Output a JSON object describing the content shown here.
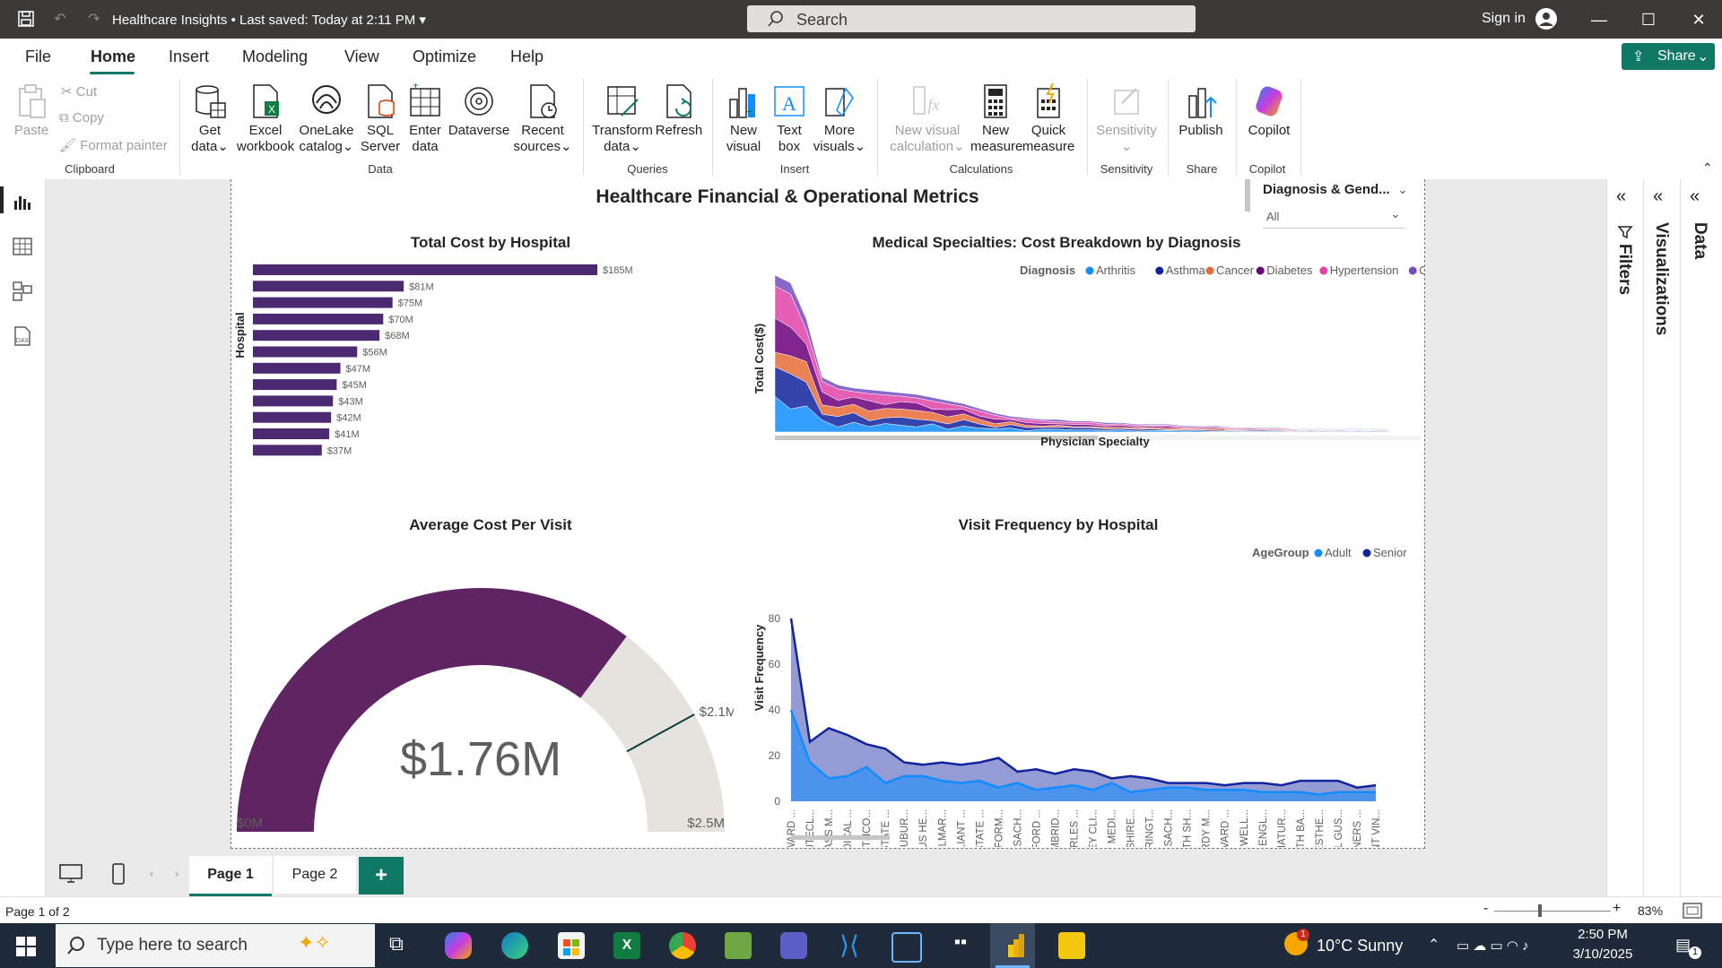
{
  "titlebar": {
    "app_title": "Healthcare Insights",
    "saved_status": "Last saved: Today at 2:11 PM",
    "search_placeholder": "Search",
    "sign_in": "Sign in"
  },
  "menu": {
    "items": [
      "File",
      "Home",
      "Insert",
      "Modeling",
      "View",
      "Optimize",
      "Help"
    ],
    "active": "Home",
    "share_label": "Share"
  },
  "ribbon": {
    "clipboard": {
      "paste": "Paste",
      "cut": "Cut",
      "copy": "Copy",
      "format_painter": "Format painter",
      "group": "Clipboard"
    },
    "data": {
      "get_data": [
        "Get",
        "data"
      ],
      "excel": [
        "Excel",
        "workbook"
      ],
      "onelake": [
        "OneLake",
        "catalog"
      ],
      "sql": [
        "SQL",
        "Server"
      ],
      "enter": [
        "Enter",
        "data"
      ],
      "dataverse": [
        "Dataverse",
        ""
      ],
      "recent": [
        "Recent",
        "sources"
      ],
      "group": "Data"
    },
    "queries": {
      "transform": [
        "Transform",
        "data"
      ],
      "refresh": [
        "Refresh",
        ""
      ],
      "group": "Queries"
    },
    "insert": {
      "new_visual": [
        "New",
        "visual"
      ],
      "text_box": [
        "Text",
        "box"
      ],
      "more_visuals": [
        "More",
        "visuals"
      ],
      "group": "Insert"
    },
    "calculations": {
      "new_visual_calc": [
        "New visual",
        "calculation"
      ],
      "new_measure": [
        "New",
        "measure"
      ],
      "quick_measure": [
        "Quick",
        "measure"
      ],
      "group": "Calculations"
    },
    "sensitivity": {
      "label": "Sensitivity",
      "group": "Sensitivity"
    },
    "share": {
      "publish": "Publish",
      "group": "Share"
    },
    "copilot": {
      "label": "Copilot",
      "group": "Copilot"
    }
  },
  "report": {
    "title": "Healthcare Financial & Operational Metrics",
    "slicer": {
      "title": "Diagnosis & Gend...",
      "value": "All"
    }
  },
  "panes": {
    "filters": "Filters",
    "visualizations": "Visualizations",
    "data": "Data"
  },
  "pages": {
    "tabs": [
      "Page 1",
      "Page 2"
    ],
    "active": "Page 1",
    "add": "+"
  },
  "status": {
    "page_info": "Page 1 of 2",
    "zoom": "83%"
  },
  "taskbar": {
    "search_placeholder": "Type here to search",
    "weather": "10°C  Sunny",
    "time": "2:50 PM",
    "date": "3/10/2025",
    "notification_count": "1"
  },
  "chart_data": [
    {
      "type": "bar",
      "title": "Total Cost by Hospital",
      "ylabel": "Hospital",
      "orientation": "horizontal",
      "values": [
        185,
        81,
        75,
        70,
        68,
        56,
        47,
        45,
        43,
        42,
        41,
        37
      ],
      "labels": [
        "$185M",
        "$81M",
        "$75M",
        "$70M",
        "$68M",
        "$56M",
        "$47M",
        "$45M",
        "$43M",
        "$42M",
        "$41M",
        "$37M"
      ],
      "color": "#4b2a72"
    },
    {
      "type": "area",
      "title": "Medical Specialties: Cost Breakdown by Diagnosis",
      "xlabel": "Physician Specialty",
      "ylabel": "Total Cost($)",
      "legend_title": "Diagnosis",
      "series": [
        {
          "name": "Arthritis",
          "color": "#118dff"
        },
        {
          "name": "Asthma",
          "color": "#12239e"
        },
        {
          "name": "Cancer",
          "color": "#e66c37"
        },
        {
          "name": "Diabetes",
          "color": "#6b007b"
        },
        {
          "name": "Hypertension",
          "color": "#e044a7"
        },
        {
          "name": "Obesity",
          "color": "#744ec2"
        }
      ],
      "totals": [
        100,
        95,
        72,
        35,
        30,
        28,
        27,
        26,
        25,
        24,
        22,
        20,
        18,
        15,
        12,
        10,
        9,
        8,
        8,
        7,
        7,
        6,
        6,
        5,
        5,
        5,
        4,
        4,
        4,
        3,
        3,
        3,
        3,
        2,
        2,
        2,
        2,
        2,
        2,
        2
      ]
    },
    {
      "type": "gauge",
      "title": "Average Cost Per Visit",
      "value": 1.76,
      "value_label": "$1.76M",
      "min": 0,
      "max": 2.5,
      "target": 2.1,
      "min_label": "$0M",
      "max_label": "$2.5M",
      "target_label": "$2.1M",
      "color": "#5f2563",
      "track_color": "#e6e2dd"
    },
    {
      "type": "area",
      "title": "Visit Frequency by Hospital",
      "ylabel": "Visit Frequency",
      "legend_title": "AgeGroup",
      "ylim": [
        0,
        80
      ],
      "yticks": [
        0,
        20,
        40,
        60,
        80
      ],
      "categories": [
        "STEWARD ...",
        "MINUTECL...",
        "UMASS M...",
        "MEDICAL ...",
        "SOUTHCO...",
        "BAYSTATE ...",
        "MT AUBUR...",
        "ATRIUS HE...",
        "HALLMAR...",
        "RELIANT ...",
        "BAY STATE ...",
        "PERFORM...",
        "MASSACH...",
        "MILFORD ...",
        "CAMBRID...",
        "CHARLES ...",
        "LAHEY CLI...",
        "LGH MEDI...",
        "BERKSHIRE...",
        "HARRINGT...",
        "MASSACH...",
        "NORTH SH...",
        "STURDY M...",
        "HARVARD ...",
        "CAREWELL...",
        "NEW ENGL...",
        "SIGNATUR...",
        "SOUTH BA...",
        "ANAESTHE...",
        "CARL GUS...",
        "PARTNERS ...",
        "SAINT VIN..."
      ],
      "series": [
        {
          "name": "Adult",
          "color": "#118dff",
          "values": [
            40,
            17,
            10,
            11,
            15,
            8,
            11,
            11,
            9,
            8,
            9,
            6,
            8,
            5,
            6,
            7,
            5,
            8,
            4,
            5,
            6,
            6,
            5,
            5,
            5,
            4,
            4,
            4,
            3,
            4,
            4,
            4
          ]
        },
        {
          "name": "Senior",
          "color": "#12239e",
          "values": [
            80,
            26,
            32,
            29,
            25,
            23,
            17,
            16,
            17,
            16,
            17,
            19,
            13,
            14,
            12,
            14,
            13,
            10,
            11,
            10,
            8,
            8,
            8,
            7,
            8,
            8,
            7,
            9,
            9,
            9,
            6,
            7
          ]
        }
      ]
    }
  ]
}
